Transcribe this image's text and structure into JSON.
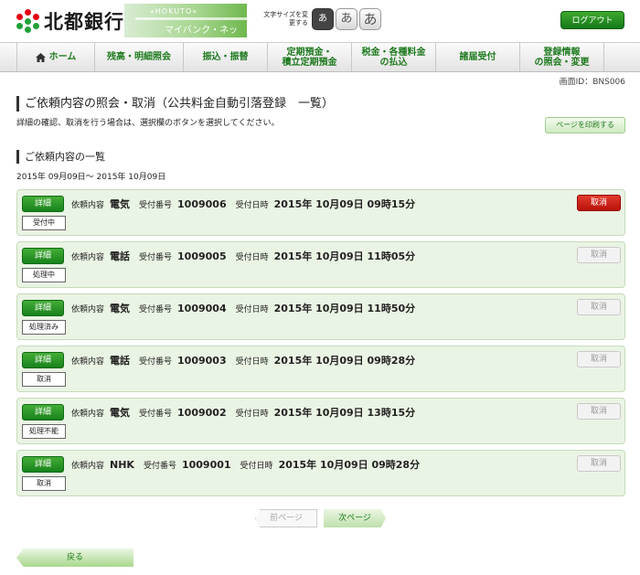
{
  "header": {
    "bank_name": "北都銀行",
    "banner_en": "«HOKUTO»",
    "banner_jp": "マイバンク・ネット",
    "fontsize_label": "文字サイズを変更する",
    "fontsize_buttons": [
      "あ",
      "あ",
      "あ"
    ],
    "logout_label": "ログアウト"
  },
  "nav": {
    "items": [
      {
        "label": "ホーム"
      },
      {
        "label": "残高・明細照会"
      },
      {
        "label": "振込・振替"
      },
      {
        "label": "定期預金・\n積立定期預金"
      },
      {
        "label": "税金・各種料金\nの払込"
      },
      {
        "label": "諸届受付"
      },
      {
        "label": "登録情報\nの照会・変更"
      }
    ]
  },
  "screen_id": "画面ID：BNS006",
  "page": {
    "title": "ご依頼内容の照会・取消（公共料金自動引落登録　一覧）",
    "description": "詳細の確認、取消を行う場合は、選択欄のボタンを選択してください。",
    "print_label": "ページを印刷する",
    "section_title": "ご依頼内容の一覧",
    "period": "2015年 09月09日～ 2015年 10月09日"
  },
  "labels": {
    "detail": "詳細",
    "content": "依頼内容",
    "receipt_no": "受付番号",
    "receipt_datetime": "受付日時",
    "cancel": "取消"
  },
  "requests": [
    {
      "content": "電気",
      "receipt_no": "1009006",
      "datetime": "2015年 10月09日 09時15分",
      "status": "受付中",
      "cancel_enabled": true
    },
    {
      "content": "電話",
      "receipt_no": "1009005",
      "datetime": "2015年 10月09日 11時05分",
      "status": "処理中",
      "cancel_enabled": false
    },
    {
      "content": "電気",
      "receipt_no": "1009004",
      "datetime": "2015年 10月09日 11時50分",
      "status": "処理済み",
      "cancel_enabled": false
    },
    {
      "content": "電話",
      "receipt_no": "1009003",
      "datetime": "2015年 10月09日 09時28分",
      "status": "取消",
      "cancel_enabled": false
    },
    {
      "content": "電気",
      "receipt_no": "1009002",
      "datetime": "2015年 10月09日 13時15分",
      "status": "処理不能",
      "cancel_enabled": false
    },
    {
      "content": "NHK",
      "receipt_no": "1009001",
      "datetime": "2015年 10月09日 09時28分",
      "status": "取消",
      "cancel_enabled": false
    }
  ],
  "pager": {
    "prev_label": "前ページ",
    "next_label": "次ページ"
  },
  "back_label": "戻る",
  "colors": {
    "brand_green": "#1f7a1f",
    "cancel_red": "#c8150e"
  }
}
